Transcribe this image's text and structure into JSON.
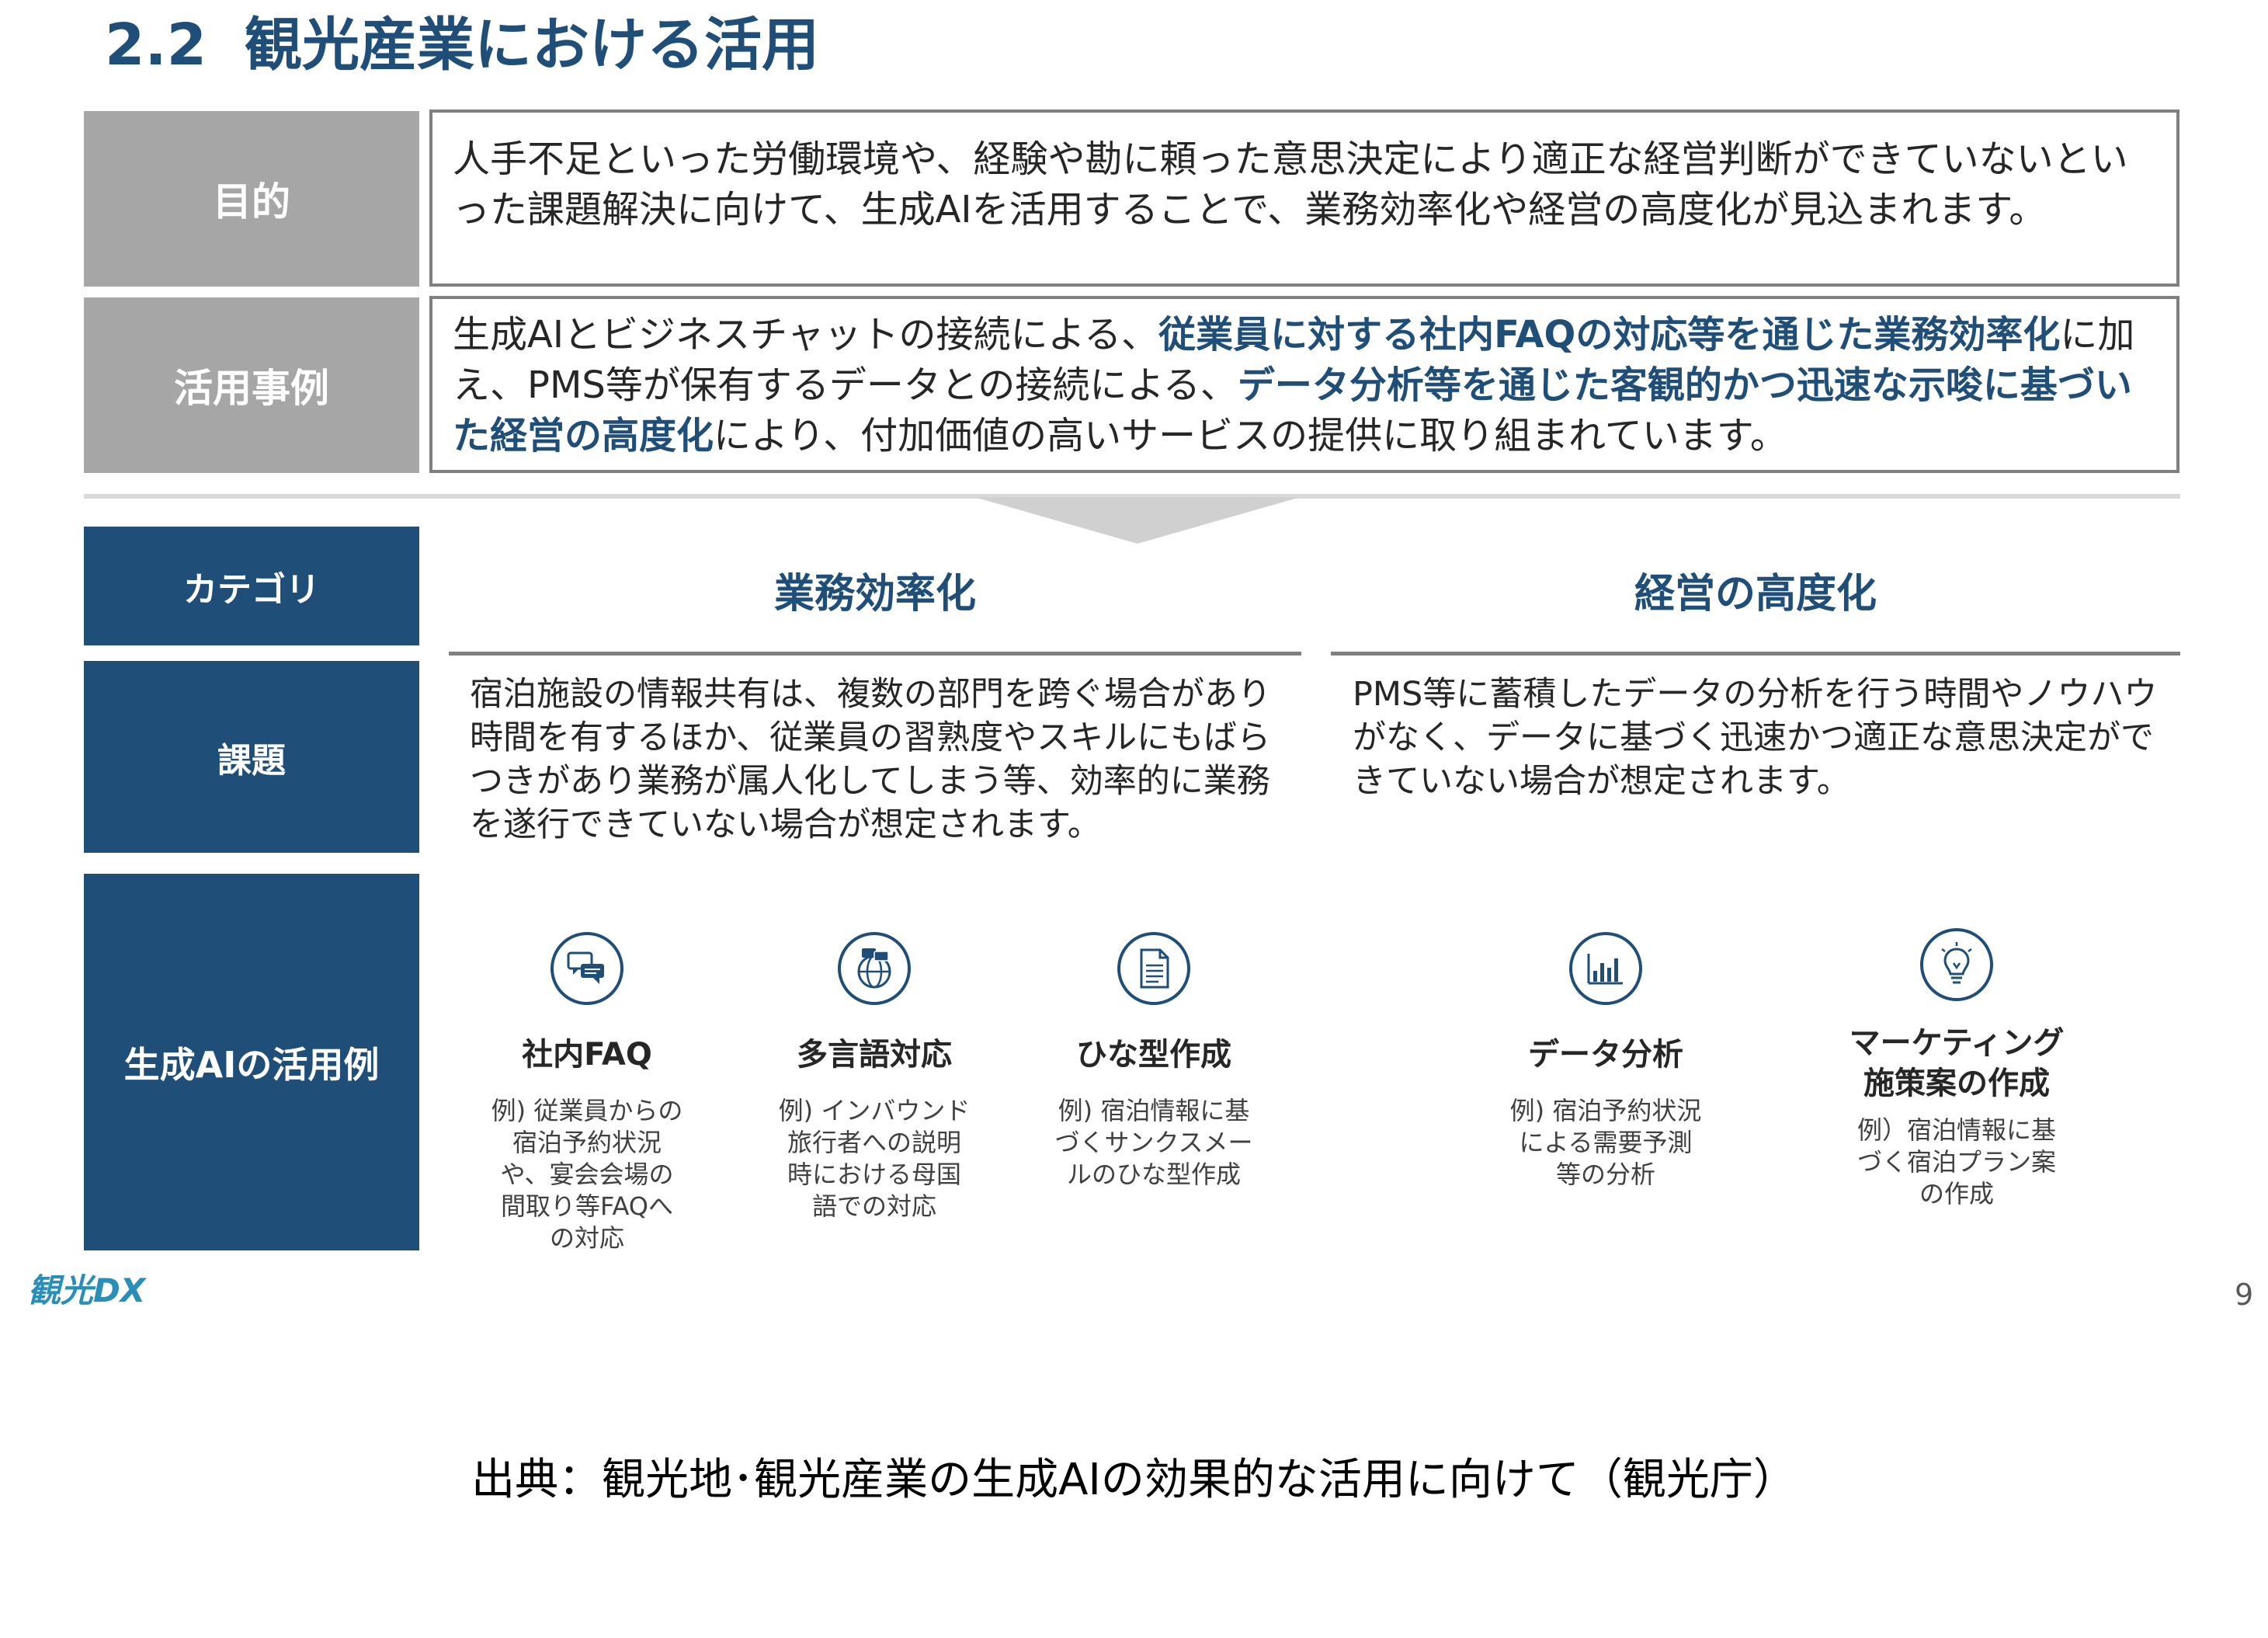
{
  "heading": {
    "number": "2.2",
    "title": "観光産業における活用"
  },
  "purpose": {
    "label": "目的",
    "text": "人手不足といった労働環境や、経験や勘に頼った意思決定により適正な経営判断ができていないといった課題解決に向けて、生成AIを活用することで、業務効率化や経営の高度化が見込まれます。"
  },
  "examples": {
    "label": "活用事例",
    "part1": "生成AIとビジネスチャットの接続による、",
    "hl1": "従業員に対する社内FAQの対応等を通じた業務効率化",
    "part2": "に加え、PMS等が保有するデータとの接続による、",
    "hl2": "データ分析等を通じた客観的かつ迅速な示唆に基づいた経営の高度化",
    "part3": "により、付加価値の高いサービスの提供に取り組まれています。"
  },
  "labels": {
    "category": "カテゴリ",
    "issue": "課題",
    "genai": "生成AIの活用例"
  },
  "categories": [
    {
      "title": "業務効率化",
      "issue": "宿泊施設の情報共有は、複数の部門を跨ぐ場合があり時間を有するほか、従業員の習熟度やスキルにもばらつきがあり業務が属人化してしまう等、効率的に業務を遂行できていない場合が想定されます。"
    },
    {
      "title": "経営の高度化",
      "issue": "PMS等に蓄積したデータの分析を行う時間やノウハウがなく、データに基づく迅速かつ適正な意思決定ができていない場合が想定されます。"
    }
  ],
  "use_cases": [
    {
      "icon": "chat-icon",
      "title": "社内FAQ",
      "desc": "例) 従業員からの宿泊予約状況や、宴会会場の間取り等FAQへの対応"
    },
    {
      "icon": "globe-chat-icon",
      "title": "多言語対応",
      "desc": "例) インバウンド旅行者への説明時における母国語での対応"
    },
    {
      "icon": "document-icon",
      "title": "ひな型作成",
      "desc": "例) 宿泊情報に基づくサンクスメールのひな型作成"
    },
    {
      "icon": "bar-chart-icon",
      "title": "データ分析",
      "desc": "例) 宿泊予約状況による需要予測等の分析"
    },
    {
      "icon": "lightbulb-icon",
      "title": "マーケティング施策案の作成",
      "desc": "例）宿泊情報に基づく宿泊プラン案の作成"
    }
  ],
  "footer": {
    "logo": "観光DX",
    "page": "9"
  },
  "source": "出典：観光地･観光産業の生成AIの効果的な活用に向けて（観光庁）",
  "colors": {
    "navy": "#1f4e79",
    "gray_label": "#a6a6a6",
    "logo": "#2a8fb8"
  }
}
